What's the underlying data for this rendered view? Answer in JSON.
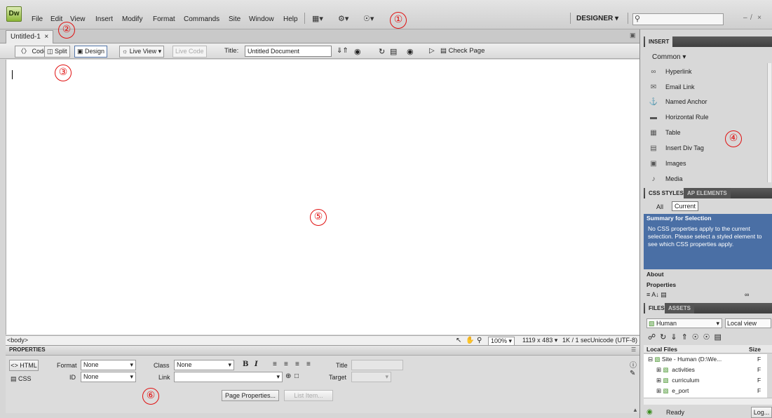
{
  "app": {
    "logo": "Dw",
    "workspace": "DESIGNER ▾",
    "search_placeholder": "",
    "window_controls": "– ̸ ×"
  },
  "menu": [
    "File",
    "Edit",
    "View",
    "Insert",
    "Modify",
    "Format",
    "Commands",
    "Site",
    "Window",
    "Help"
  ],
  "toolbar_icons": [
    "▦▾",
    "⚙▾",
    "☉▾"
  ],
  "annotations": [
    "①",
    "②",
    "③",
    "④",
    "⑤",
    "⑥"
  ],
  "document": {
    "tab": "Untitled-1",
    "tab_close": "×"
  },
  "doc_toolbar": {
    "code": "Code",
    "split": "Split",
    "design": "Design",
    "live_view": "Live View",
    "live_code": "Live Code",
    "title_label": "Title:",
    "title_value": "Untitled Document",
    "check_page": "Check Page"
  },
  "status": {
    "tag": "<body>",
    "zoom": "100%",
    "size": "1119 x 483",
    "download": "1K / 1 sec",
    "encoding": "Unicode (UTF-8)"
  },
  "properties": {
    "header": "PROPERTIES",
    "html_btn": "<> HTML",
    "css_btn": "CSS",
    "format_label": "Format",
    "format_value": "None",
    "class_label": "Class",
    "class_value": "None",
    "id_label": "ID",
    "id_value": "None",
    "link_label": "Link",
    "link_value": "",
    "title_label": "Title",
    "target_label": "Target",
    "bold": "B",
    "italic": "I",
    "page_properties": "Page Properties...",
    "list_item": "List Item..."
  },
  "insert_panel": {
    "tab": "INSERT",
    "category": "Common ▾",
    "items": [
      {
        "label": "Hyperlink",
        "icon": "link-icon"
      },
      {
        "label": "Email Link",
        "icon": "email-icon"
      },
      {
        "label": "Named Anchor",
        "icon": "anchor-icon"
      },
      {
        "label": "Horizontal Rule",
        "icon": "rule-icon"
      },
      {
        "label": "Table",
        "icon": "table-icon"
      },
      {
        "label": "Insert Div Tag",
        "icon": "div-icon"
      },
      {
        "label": "Images",
        "icon": "image-icon"
      },
      {
        "label": "Media",
        "icon": "media-icon"
      }
    ]
  },
  "css_panel": {
    "tabs": [
      "CSS STYLES",
      "AP ELEMENTS"
    ],
    "modes": [
      "All",
      "Current"
    ],
    "summary_header": "Summary for Selection",
    "summary_text": "No CSS properties apply to the current selection.  Please select a styled element to see which CSS properties apply.",
    "about": "About",
    "properties": "Properties"
  },
  "files_panel": {
    "tabs": [
      "FILES",
      "ASSETS"
    ],
    "site": "Human",
    "view": "Local view",
    "col_local": "Local Files",
    "col_size": "Size",
    "tree": [
      {
        "label": "Site - Human (D:\\We...",
        "flag": "F"
      },
      {
        "label": "activities",
        "flag": "F"
      },
      {
        "label": "curriculum",
        "flag": "F"
      },
      {
        "label": "e_port",
        "flag": "F"
      }
    ],
    "status": "Ready",
    "log": "Log..."
  },
  "colors": {
    "accent": "#e01010",
    "logo_green": "#8bb635",
    "panel_dark": "#4a4a4a",
    "summary_blue": "#4a6fa5"
  }
}
